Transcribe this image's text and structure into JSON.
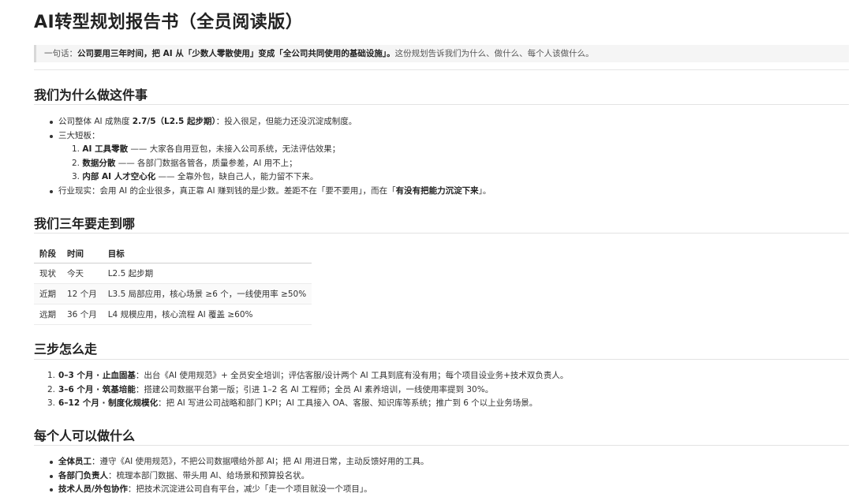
{
  "title": "AI转型规划报告书（全员阅读版）",
  "summary": {
    "prefix": "一句话：",
    "bold": "公司要用三年时间，把 AI 从「少数人零散使用」变成「全公司共同使用的基础设施」。",
    "rest": "这份规划告诉我们为什么、做什么、每个人该做什么。"
  },
  "why": {
    "heading": "我们为什么做这件事",
    "maturity": {
      "pre": "公司整体 AI 成熟度 ",
      "bold": "2.7/5（L2.5 起步期）",
      "post": "：投入很足，但能力还没沉淀成制度。"
    },
    "weak_label": "三大短板：",
    "weaknesses": [
      {
        "num": "1.",
        "bold": "AI 工具零散",
        "text": " —— 大家各自用豆包，未接入公司系统，无法评估效果；"
      },
      {
        "num": "2.",
        "bold": "数据分散",
        "text": " —— 各部门数据各管各，质量参差，AI 用不上；"
      },
      {
        "num": "3.",
        "bold": "内部 AI 人才空心化",
        "text": " —— 全靠外包，缺自己人，能力留不下来。"
      }
    ],
    "industry": {
      "pre": "行业现实：会用 AI 的企业很多，真正靠 AI 赚到钱的是少数。差距不在「要不要用」，而在「",
      "bold": "有没有把能力沉淀下来",
      "post": "」。"
    }
  },
  "goals": {
    "heading": "我们三年要走到哪",
    "columns": [
      "阶段",
      "时间",
      "目标"
    ],
    "rows": [
      [
        "现状",
        "今天",
        "L2.5 起步期"
      ],
      [
        "近期",
        "12 个月",
        "L3.5 局部应用，核心场景 ≥6 个，一线使用率 ≥50%"
      ],
      [
        "远期",
        "36 个月",
        "L4 规模应用，核心流程 AI 覆盖 ≥60%"
      ]
    ]
  },
  "steps": {
    "heading": "三步怎么走",
    "items": [
      {
        "num": "1.",
        "bold": "0–3 个月 · 止血固基",
        "text": "：出台《AI 使用规范》+ 全员安全培训；评估客服/设计两个 AI 工具到底有没有用；每个项目设业务+技术双负责人。"
      },
      {
        "num": "2.",
        "bold": "3–6 个月 · 筑基培能",
        "text": "：搭建公司数据平台第一版；引进 1–2 名 AI 工程师；全员 AI 素养培训，一线使用率提到 30%。"
      },
      {
        "num": "3.",
        "bold": "6–12 个月 · 制度化规模化",
        "text": "：把 AI 写进公司战略和部门 KPI；AI 工具接入 OA、客服、知识库等系统；推广到 6 个以上业务场景。"
      }
    ]
  },
  "people": {
    "heading": "每个人可以做什么",
    "items": [
      {
        "bold": "全体员工",
        "text": "：遵守《AI 使用规范》，不把公司数据喂给外部 AI；把 AI 用进日常，主动反馈好用的工具。"
      },
      {
        "bold": "各部门负责人",
        "text": "：梳理本部门数据、带头用 AI、给场景和预算投名状。"
      },
      {
        "bold": "技术人员/外包协作",
        "text": "：把技术沉淀进公司自有平台，减少「走一个项目就没一个项目」。"
      }
    ]
  }
}
